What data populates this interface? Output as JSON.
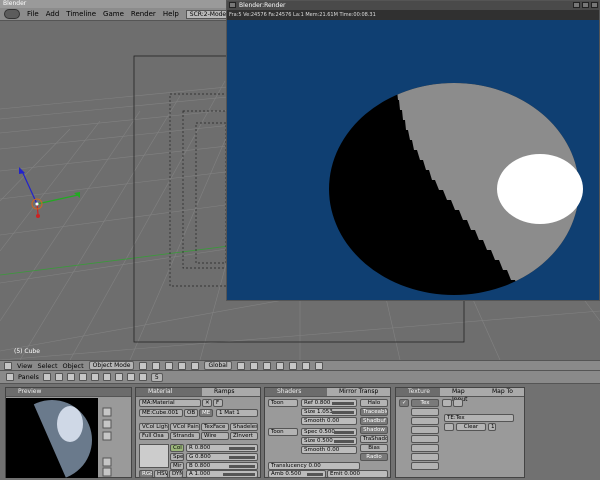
{
  "app": {
    "title": "Blender"
  },
  "menubar": {
    "items": [
      "File",
      "Add",
      "Timeline",
      "Game",
      "Render",
      "Help"
    ],
    "screen": "SCR:2-Model"
  },
  "viewport": {
    "object_label": "(5) Cube"
  },
  "render_window": {
    "title": "Blender:Render",
    "stats": "Fra:5  Ve:24576 Fa:24576 La:1  Mem:21.61M Time:00:08.31",
    "background_color": "#0f3f72",
    "sphere_light": "#8c8c8c",
    "sphere_dark": "#000000",
    "highlight": "#ffffff"
  },
  "view_header": {
    "menus": [
      "View",
      "Select",
      "Object"
    ],
    "mode": "Object Mode",
    "transform": "Global",
    "layer_frame": "5"
  },
  "buttons_header": {
    "panels_label": "Panels",
    "frame": "5"
  },
  "preview": {
    "title": "Preview"
  },
  "material": {
    "tabs": [
      "Material",
      "Ramps"
    ],
    "ma_name": "MA:Material",
    "f_label": "F",
    "me_name": "ME:Cube.001",
    "ob_label": "OB",
    "me_label": "ME",
    "mat_count": "1 Mat 1",
    "buttons_row1": [
      "VCol Light",
      "VCol Paint",
      "TexFace",
      "Shadeless"
    ],
    "buttons_row2": [
      "Full Osa",
      "Strands",
      "Wire",
      "ZInvert"
    ],
    "color_labels": [
      "Col",
      "Spe",
      "Mir"
    ],
    "rgb_labels": [
      "R 0.800",
      "G 0.800",
      "B 0.800"
    ],
    "mode_labels": [
      "RGB",
      "HSV",
      "DYN"
    ],
    "alpha": "A 1.000"
  },
  "shaders": {
    "tabs": [
      "Shaders",
      "Mirror Transp"
    ],
    "diffuse_shader": "Toon",
    "specular_shader": "Toon",
    "ref": "Ref  0.800",
    "size1": "Size 1.053",
    "smooth1": "Smooth 0.00",
    "spec": "Spec 0.500",
    "size2": "Size 0.500",
    "smooth2": "Smooth 0.00",
    "buttons": [
      "Halo",
      "Traceable",
      "Shadbuf",
      "Shadow",
      "TraShadow",
      "Bias",
      "Radio"
    ],
    "transl": "Translucency 0.00",
    "amb": "Amb 0.500",
    "emit": "Emit 0.000"
  },
  "texture": {
    "tabs": [
      "Texture",
      "Map Input",
      "Map To"
    ],
    "slot": "Tex",
    "tex_name": "TE:Tex",
    "clear": "Clear",
    "number": "1"
  }
}
